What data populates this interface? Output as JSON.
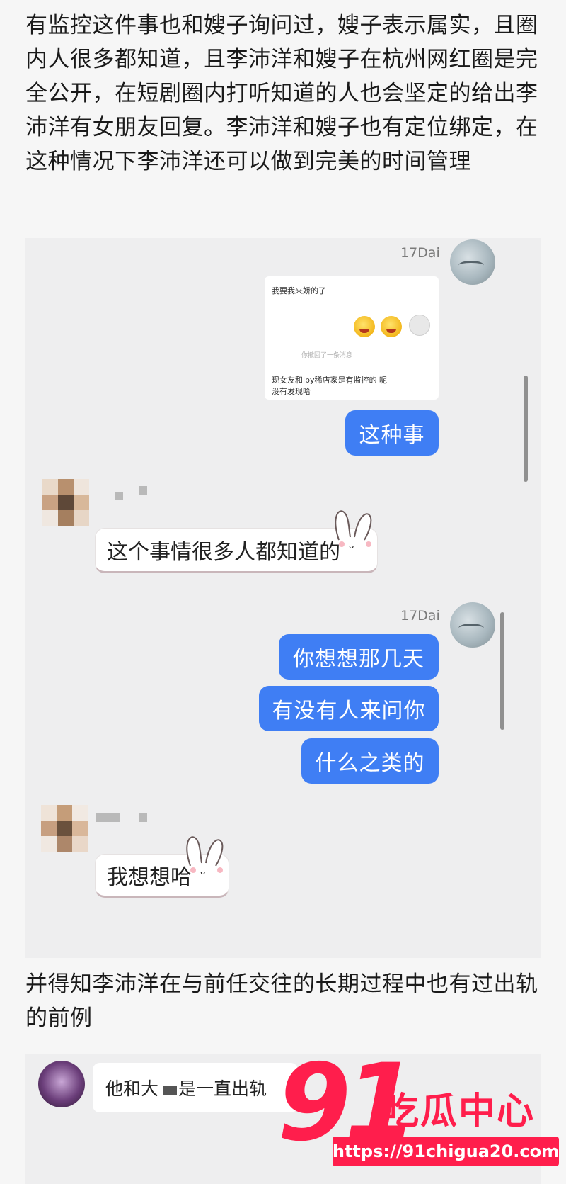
{
  "article": {
    "paragraph1": "有监控这件事也和嫂子询问过，嫂子表示属实，且圈内人很多都知道，且李沛洋和嫂子在杭州网红圈是完全公开，在短剧圈内打听知道的人也会坚定的给出李沛洋有女朋友回复。李沛洋和嫂子也有定位绑定，在这种情况下李沛洋还可以做到完美的时间管理",
    "paragraph2": "并得知李沛洋在与前任交往的长期过程中也有过出轨的前例"
  },
  "chat1": {
    "sender_me": "17Dai",
    "forwarded": {
      "line1": "我要我来娇的了",
      "recall": "你撤回了一条消息",
      "line2": "现女友和ipy稀店家是有监控的 呢",
      "line3": "没有发现哈"
    },
    "msg_me_1": "这种事",
    "msg_other_1": "这个事情很多人都知道的",
    "msg_me_2a": "你想想那几天",
    "msg_me_2b": "有没有人来问你",
    "msg_me_2c": "什么之类的",
    "msg_other_2": "我想想哈",
    "bunny_face": "ˆᴗˆ"
  },
  "chat2": {
    "msg_part1": "他和大",
    "msg_part2": "是一直出轨"
  },
  "watermark": {
    "number": "91",
    "name": "吃瓜中心",
    "url": "https://91chigua20.com"
  },
  "colors": {
    "blue_bubble": "#3f7ef4",
    "watermark_red": "#ff1e4c"
  }
}
